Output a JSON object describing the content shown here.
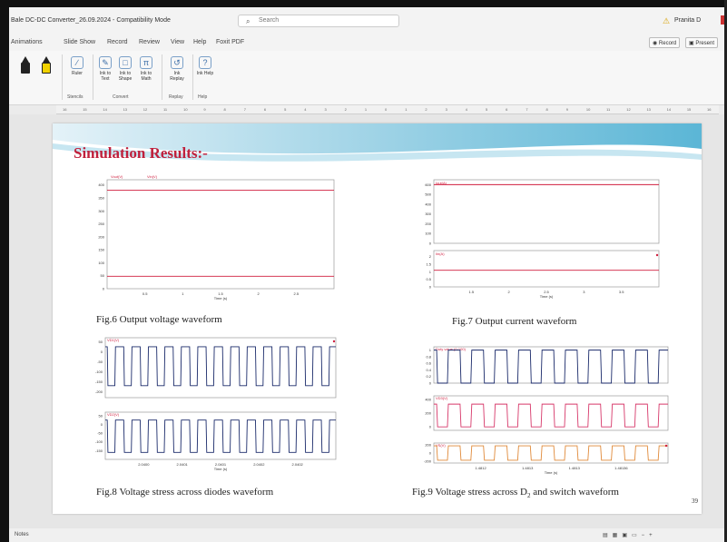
{
  "window": {
    "file_title": "Bale DC-DC Converter_26.09.2024 - Compatibility Mode",
    "search_placeholder": "Search",
    "user_name": "Pranita D"
  },
  "ribbon_tabs": [
    "Animations",
    "Slide Show",
    "Record",
    "Review",
    "View",
    "Help",
    "Foxit PDF"
  ],
  "toolbar": {
    "record_label": "Record",
    "present_label": "Present"
  },
  "ribbon": {
    "buttons": [
      {
        "label": "Ruler",
        "icon": "ruler-icon"
      },
      {
        "label": "Ink to Text",
        "icon": "ink-to-text-icon"
      },
      {
        "label": "Ink to Shape",
        "icon": "ink-to-shape-icon"
      },
      {
        "label": "Ink to Math",
        "icon": "ink-to-math-icon"
      },
      {
        "label": "Ink Replay",
        "icon": "ink-replay-icon"
      },
      {
        "label": "Ink Help",
        "icon": "ink-help-icon"
      }
    ],
    "groups": [
      "Stencils",
      "Convert",
      "Replay",
      "Help"
    ]
  },
  "ruler_ticks": [
    "16",
    "15",
    "14",
    "13",
    "12",
    "11",
    "10",
    "9",
    "8",
    "7",
    "6",
    "5",
    "4",
    "3",
    "2",
    "1",
    "0",
    "1",
    "2",
    "3",
    "4",
    "5",
    "6",
    "7",
    "8",
    "9",
    "10",
    "11",
    "12",
    "13",
    "14",
    "15",
    "16"
  ],
  "slide": {
    "title": "Simulation Results:-",
    "page_number": "39",
    "captions": {
      "fig6": "Fig.6 Output voltage waveform",
      "fig7": "Fig.7 Output current waveform",
      "fig8": "Fig.8 Voltage stress across diodes  waveform",
      "fig9": "Fig.9 Voltage stress across D",
      "fig9_sub": "2",
      "fig9_tail": " and switch waveform"
    }
  },
  "status": {
    "notes": "Notes"
  },
  "colors": {
    "accent": "#c0203c",
    "series_red": "#d01f3f",
    "series_blue": "#1a2a6a",
    "series_pink": "#d7386a",
    "series_orange": "#e08a3a"
  },
  "chart_data": [
    {
      "id": "fig6",
      "type": "line",
      "legend": [
        "Vout(V)",
        "Vin(V)"
      ],
      "yticks": [
        0,
        50,
        100,
        150,
        200,
        250,
        300,
        350,
        400
      ],
      "ylim": [
        0,
        420
      ],
      "xticks": [
        "0.5",
        "1",
        "1.5",
        "2",
        "2.5"
      ],
      "xlim": [
        0,
        3
      ],
      "xlabel": "Time (s)",
      "series": [
        {
          "name": "Vout(V)",
          "x": [
            0,
            3
          ],
          "y": [
            380,
            380
          ]
        },
        {
          "name": "Vin(V)",
          "x": [
            0,
            3
          ],
          "y": [
            48,
            48
          ]
        }
      ]
    },
    {
      "id": "fig7",
      "type": "line",
      "panels": [
        {
          "legend": "Iout(A)",
          "yticks": [
            0,
            100,
            200,
            300,
            400,
            500,
            600
          ],
          "ylim": [
            0,
            650
          ],
          "series": [
            {
              "name": "Iout(A)",
              "x": [
                0,
                4
              ],
              "y": [
                600,
                600
              ]
            }
          ]
        },
        {
          "legend": "Iin(A)",
          "yticks": [
            0,
            0.5,
            1,
            1.5,
            2
          ],
          "ylim": [
            0,
            2.4
          ],
          "series": [
            {
              "name": "Iin(A)",
              "x": [
                0,
                4
              ],
              "y": [
                1.1,
                1.1
              ]
            }
          ]
        }
      ],
      "xticks": [
        "1.5",
        "2",
        "2.5",
        "3",
        "3.5"
      ],
      "xlabel": "Time (s)"
    },
    {
      "id": "fig8",
      "type": "line",
      "panels": [
        {
          "legend": "VD1(V)",
          "yticks": [
            50,
            0,
            -50,
            -100,
            -150,
            -200
          ],
          "ylim": [
            -230,
            70
          ],
          "high": 25,
          "low": -170,
          "cycles": 14
        },
        {
          "legend": "VD2(V)",
          "yticks": [
            50,
            0,
            -50,
            -100,
            -150
          ],
          "ylim": [
            -200,
            70
          ],
          "high": 25,
          "low": -160,
          "cycles": 14
        }
      ],
      "xticks": [
        "2.0400",
        "2.0401",
        "2.0401",
        "2.0402",
        "2.0402"
      ],
      "xlabel": "Time (s)"
    },
    {
      "id": "fig9",
      "type": "line",
      "panels": [
        {
          "legend": "Duty value (0-100)",
          "yticks": [
            1,
            0.8,
            0.6,
            0.4,
            0.2,
            0
          ],
          "ylim": [
            0,
            1.1
          ],
          "high": 1,
          "low": 0,
          "cycles": 10
        },
        {
          "legend": "VD3(V)",
          "yticks": [
            400,
            200,
            0
          ],
          "ylim": [
            -50,
            450
          ],
          "high": 330,
          "low": 0,
          "cycles": 10
        },
        {
          "legend": "VS(V)",
          "yticks": [
            200,
            0,
            -200
          ],
          "ylim": [
            -250,
            250
          ],
          "high": 180,
          "low": -180,
          "cycles": 10
        }
      ],
      "xticks": [
        "1.4812",
        "1.4813",
        "1.4813",
        "1.48136"
      ],
      "xlabel": "Time (s)"
    }
  ]
}
